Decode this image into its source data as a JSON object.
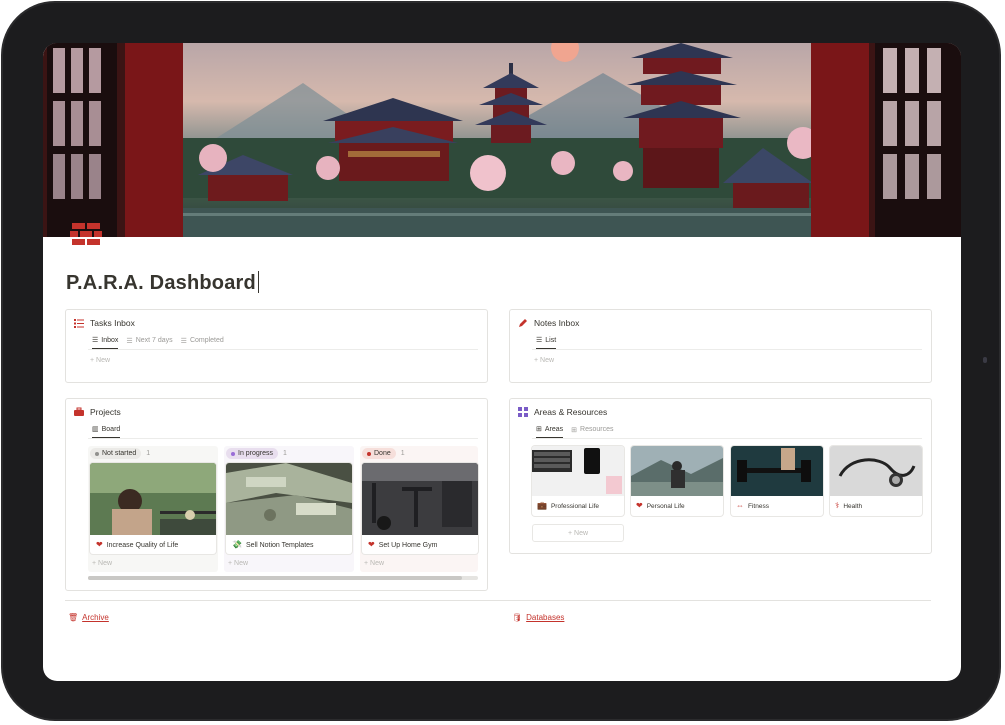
{
  "page": {
    "title": "P.A.R.A. Dashboard",
    "accent_color": "#c4332c",
    "icon": "brick-wall-icon",
    "cover": "pixel-art-japanese-temple-cover"
  },
  "tasks_inbox": {
    "title": "Tasks Inbox",
    "icon": "checklist-icon",
    "views": [
      "Inbox",
      "Next 7 days",
      "Completed"
    ],
    "new_label": "New"
  },
  "notes_inbox": {
    "title": "Notes Inbox",
    "icon": "pencil-icon",
    "views": [
      "List"
    ],
    "new_label": "New"
  },
  "projects": {
    "title": "Projects",
    "icon": "briefcase-icon",
    "views": [
      "Board"
    ],
    "columns": [
      {
        "status": "Not started",
        "count": "1",
        "card": "Increase Quality of Life",
        "card_icon": "heart-icon",
        "new_label": "New"
      },
      {
        "status": "In progress",
        "count": "1",
        "card": "Sell Notion Templates",
        "card_icon": "money-icon",
        "new_label": "New"
      },
      {
        "status": "Done",
        "count": "1",
        "card": "Set Up Home Gym",
        "card_icon": "heart-icon",
        "new_label": "New"
      }
    ]
  },
  "areas_resources": {
    "title": "Areas & Resources",
    "icon": "grid-icon",
    "views": [
      "Areas",
      "Resources"
    ],
    "cards": [
      {
        "label": "Professional Life",
        "icon": "briefcase-icon"
      },
      {
        "label": "Personal Life",
        "icon": "heart-icon"
      },
      {
        "label": "Fitness",
        "icon": "dumbbell-icon"
      },
      {
        "label": "Health",
        "icon": "stethoscope-icon"
      }
    ],
    "new_label": "New"
  },
  "footer": {
    "archive": "Archive",
    "databases": "Databases"
  }
}
